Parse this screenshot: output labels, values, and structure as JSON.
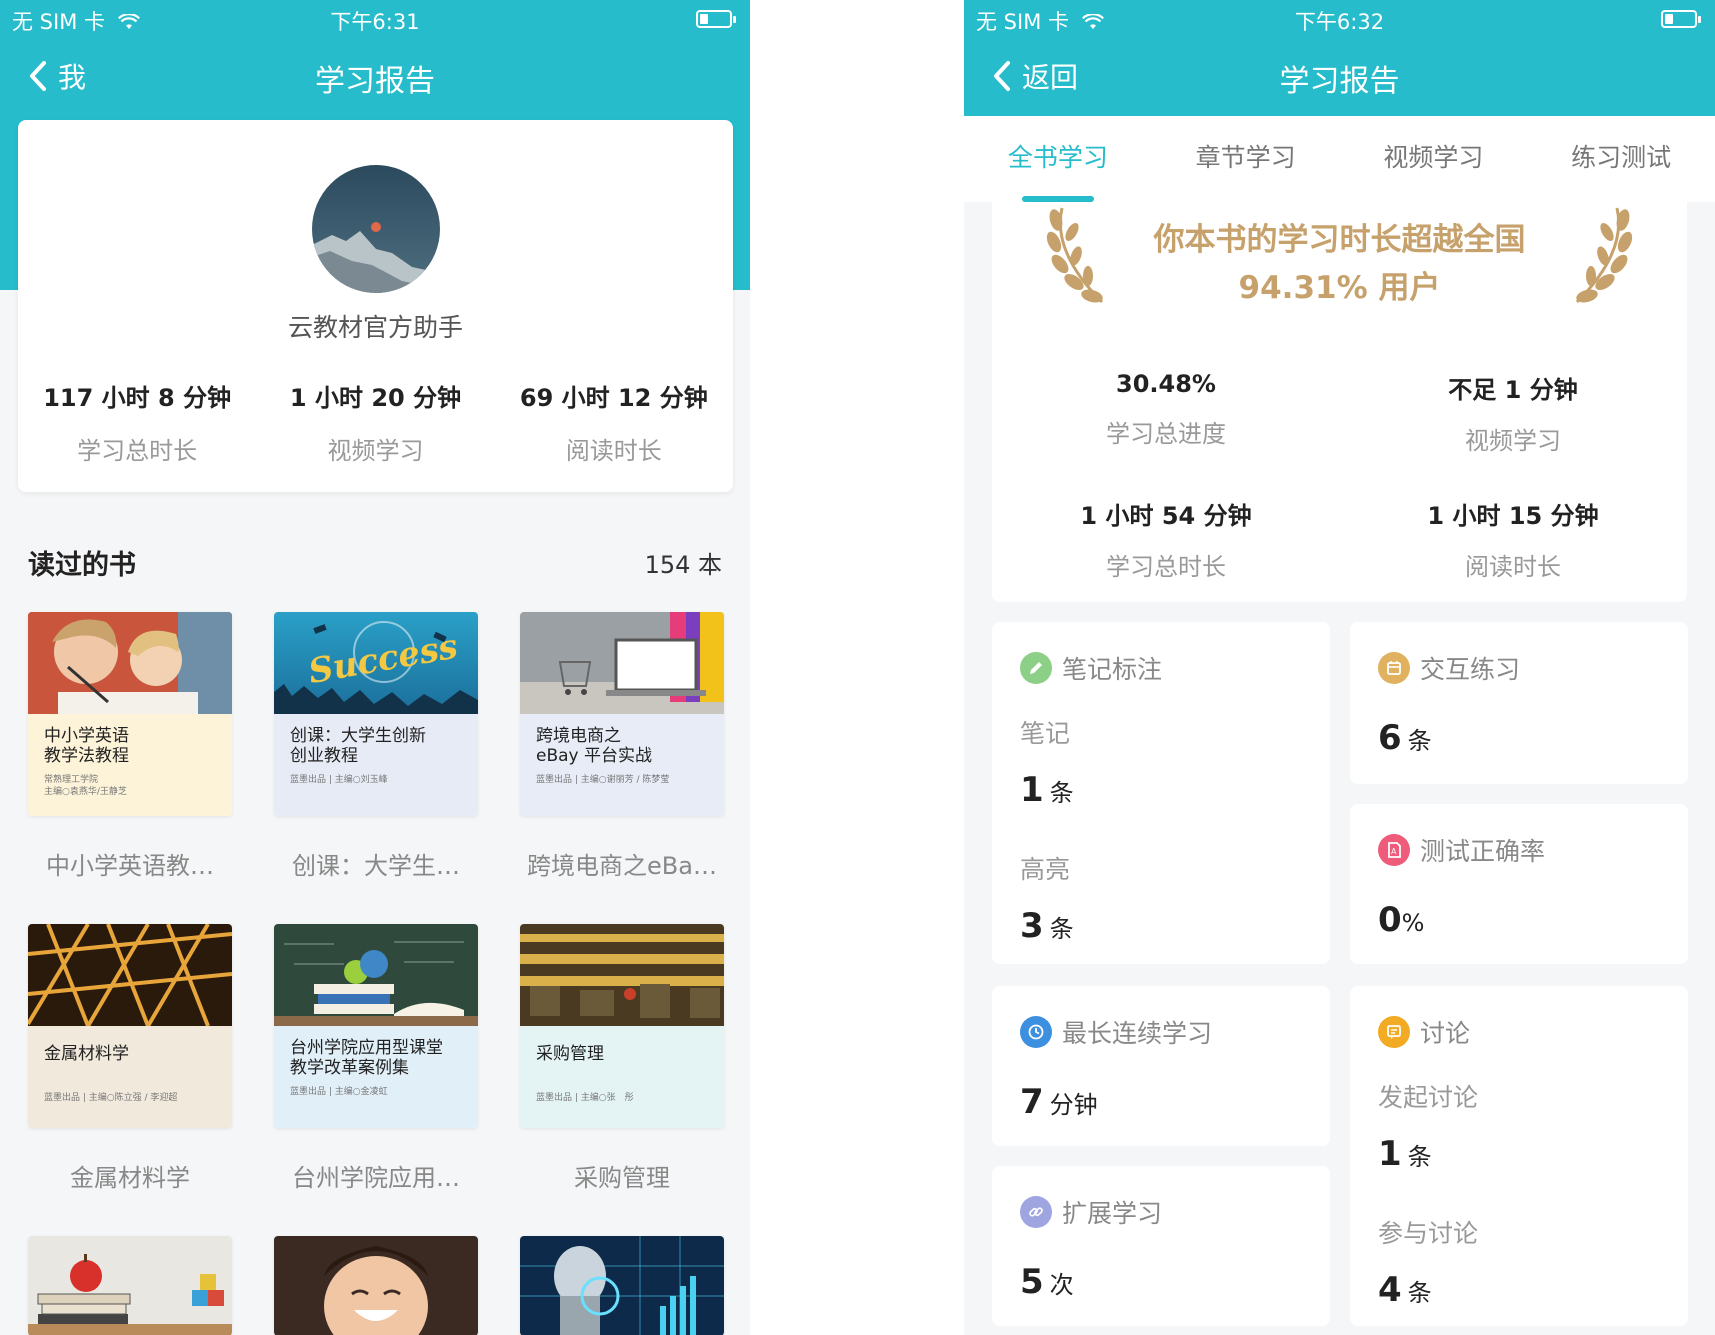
{
  "left": {
    "status": {
      "carrier": "无 SIM 卡",
      "time": "下午6:31"
    },
    "nav": {
      "back_label": "我",
      "title": "学习报告"
    },
    "profile": {
      "name": "云教材官方助手",
      "stats": [
        {
          "value": "117 小时 8 分钟",
          "label": "学习总时长"
        },
        {
          "value": "1 小时 20 分钟",
          "label": "视频学习"
        },
        {
          "value": "69 小时 12 分钟",
          "label": "阅读时长"
        }
      ]
    },
    "books_header": {
      "title": "读过的书",
      "count": "154 本"
    },
    "books": [
      {
        "cover_title": "中小学英语\n教学法教程",
        "cover_sub": "常熟理工学院\n主编○袁燕华/王静芝",
        "caption": "中小学英语教…",
        "bg": "#fdf3d8"
      },
      {
        "cover_title": "创课：大学生创新\n创业教程",
        "cover_sub": "蓝墨出品 | 主编○刘玉峰",
        "caption": "创课：大学生…",
        "bg": "#e6ebf6"
      },
      {
        "cover_title": "跨境电商之\neBay 平台实战",
        "cover_sub": "蓝墨出品 | 主编○谢丽芳 / 陈梦莹",
        "caption": "跨境电商之eBa…",
        "bg": "#e7ecf7"
      },
      {
        "cover_title": "金属材料学",
        "cover_sub": "蓝墨出品 | 主编○陈立强 / 李迎超",
        "caption": "金属材料学",
        "bg": "#f2e9dd"
      },
      {
        "cover_title": "台州学院应用型课堂\n教学改革案例集",
        "cover_sub": "蓝墨出品 | 主编○金凌虹",
        "caption": "台州学院应用…",
        "bg": "#e1eff8"
      },
      {
        "cover_title": "采购管理",
        "cover_sub": "蓝墨出品 | 主编○张　彤",
        "caption": "采购管理",
        "bg": "#e4f4f5"
      }
    ]
  },
  "right": {
    "status": {
      "carrier": "无 SIM 卡",
      "time": "下午6:32"
    },
    "nav": {
      "back_label": "返回",
      "title": "学习报告"
    },
    "tabs": [
      "全书学习",
      "章节学习",
      "视频学习",
      "练习测试"
    ],
    "rank": {
      "line1": "你本书的学习时长超越全国",
      "line2": "94.31% 用户"
    },
    "summary": [
      {
        "value": "30.48%",
        "label": "学习总进度"
      },
      {
        "value": "不足 1 分钟",
        "label": "视频学习"
      },
      {
        "value": "1 小时 54 分钟",
        "label": "学习总时长"
      },
      {
        "value": "1 小时 15 分钟",
        "label": "阅读时长"
      }
    ],
    "cards": {
      "notes": {
        "title": "笔记标注",
        "icon": "pencil-icon",
        "color": "#8ccf86",
        "note_label": "笔记",
        "note_num": "1",
        "note_unit": "条",
        "hl_label": "高亮",
        "hl_num": "3",
        "hl_unit": "条"
      },
      "practice": {
        "title": "交互练习",
        "icon": "calendar-icon",
        "color": "#e0b15e",
        "num": "6",
        "unit": "条"
      },
      "accuracy": {
        "title": "测试正确率",
        "icon": "test-doc-icon",
        "color": "#ef5b7b",
        "num": "0",
        "unit": "%"
      },
      "streak": {
        "title": "最长连续学习",
        "icon": "clock-icon",
        "color": "#3d8fe0",
        "num": "7",
        "unit": "分钟"
      },
      "discussion": {
        "title": "讨论",
        "icon": "discussion-icon",
        "color": "#f2ab22",
        "start_label": "发起讨论",
        "start_num": "1",
        "start_unit": "条",
        "join_label": "参与讨论",
        "join_num": "4",
        "join_unit": "条"
      },
      "extend": {
        "title": "扩展学习",
        "icon": "link-icon",
        "color": "#9ea5e0",
        "num": "5",
        "unit": "次"
      }
    }
  }
}
